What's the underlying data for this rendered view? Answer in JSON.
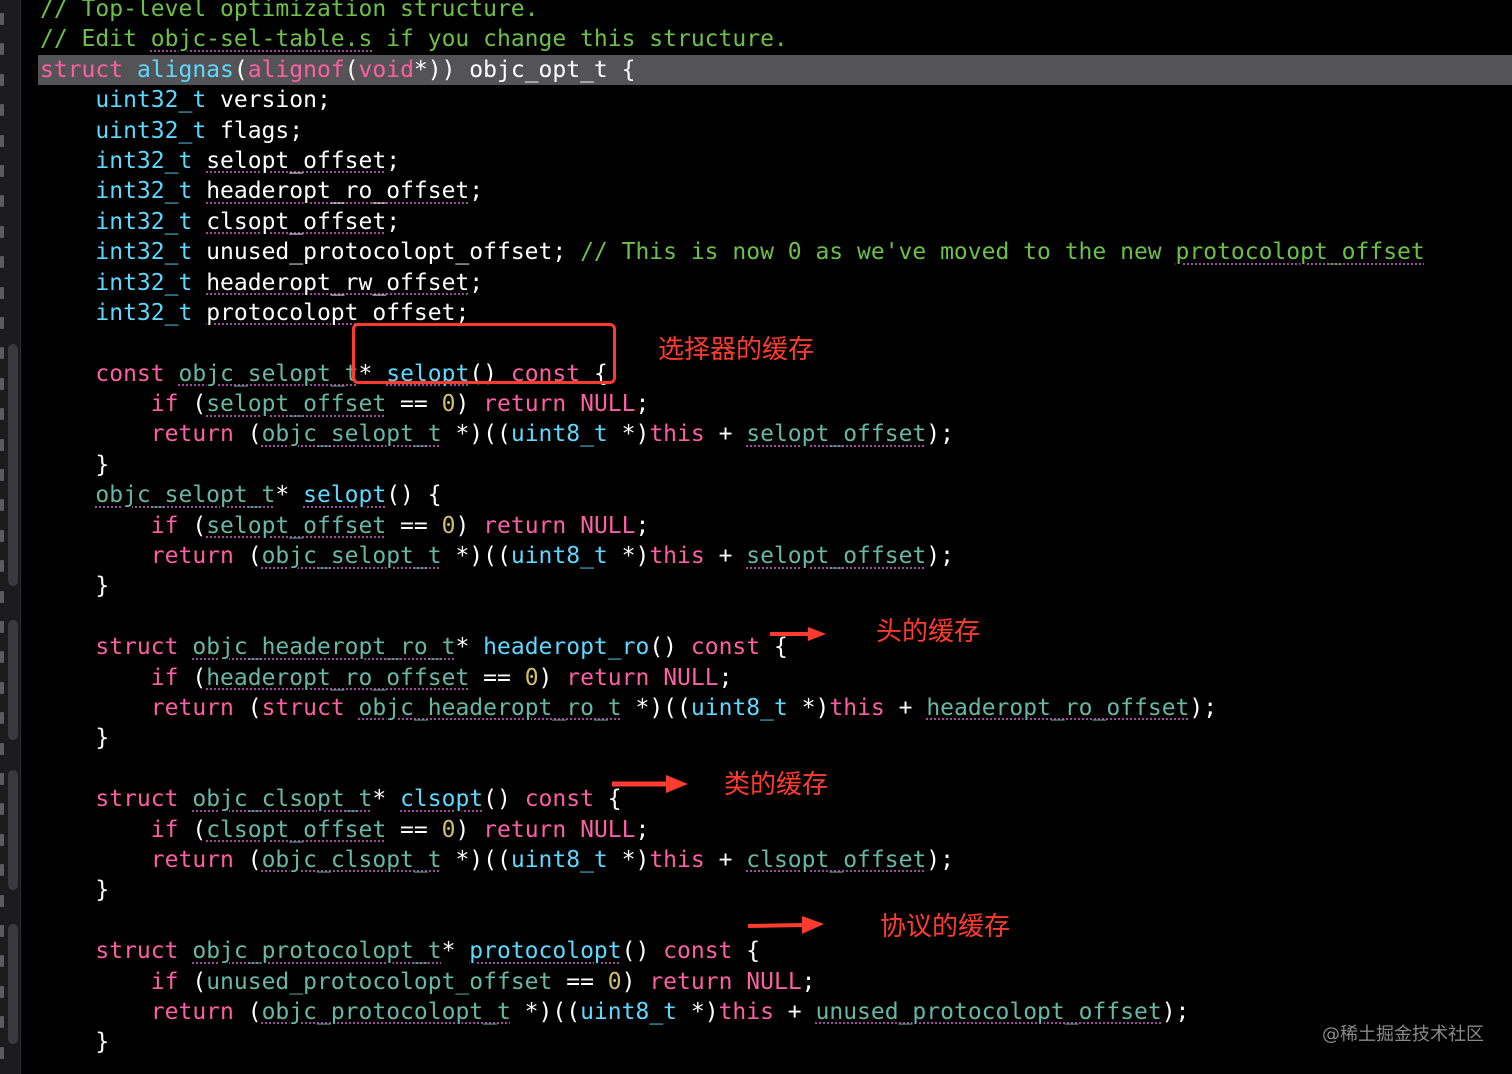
{
  "editor": {
    "lines": [
      [
        [
          "// Top-level optimization structure.",
          "cm"
        ]
      ],
      [
        [
          "// Edit ",
          "cm"
        ],
        [
          "objc-sel-table.s",
          "cm sq"
        ],
        [
          " if you change this structure.",
          "cm"
        ]
      ],
      [
        [
          "struct ",
          "kw"
        ],
        [
          "alignas",
          "ty"
        ],
        [
          "(",
          "pl"
        ],
        [
          "alignof",
          "kw"
        ],
        [
          "(",
          "pl"
        ],
        [
          "void",
          "kw"
        ],
        [
          "*)) objc_opt_t {",
          "pl"
        ]
      ],
      [
        [
          "    ",
          "pl"
        ],
        [
          "uint32_t",
          "ty"
        ],
        [
          " version;",
          "pl"
        ]
      ],
      [
        [
          "    ",
          "pl"
        ],
        [
          "uint32_t",
          "ty"
        ],
        [
          " flags;",
          "pl"
        ]
      ],
      [
        [
          "    ",
          "pl"
        ],
        [
          "int32_t",
          "ty"
        ],
        [
          " ",
          "pl"
        ],
        [
          "selopt_offset",
          "pl sq"
        ],
        [
          ";",
          "pl"
        ]
      ],
      [
        [
          "    ",
          "pl"
        ],
        [
          "int32_t",
          "ty"
        ],
        [
          " ",
          "pl"
        ],
        [
          "headeropt_ro_offset",
          "pl sq"
        ],
        [
          ";",
          "pl"
        ]
      ],
      [
        [
          "    ",
          "pl"
        ],
        [
          "int32_t",
          "ty"
        ],
        [
          " ",
          "pl"
        ],
        [
          "clsopt_offset",
          "pl sq"
        ],
        [
          ";",
          "pl"
        ]
      ],
      [
        [
          "    ",
          "pl"
        ],
        [
          "int32_t",
          "ty"
        ],
        [
          " unused_protocolopt_offset; ",
          "pl"
        ],
        [
          "// This is now 0 as we've moved to the new ",
          "cm"
        ],
        [
          "protocolopt_offset",
          "cm sq"
        ]
      ],
      [
        [
          "    ",
          "pl"
        ],
        [
          "int32_t",
          "ty"
        ],
        [
          " ",
          "pl"
        ],
        [
          "headeropt_rw_offset",
          "pl sq"
        ],
        [
          ";",
          "pl"
        ]
      ],
      [
        [
          "    ",
          "pl"
        ],
        [
          "int32_t",
          "ty"
        ],
        [
          " ",
          "pl"
        ],
        [
          "protocolopt_offset",
          "pl sq"
        ],
        [
          ";",
          "pl"
        ]
      ],
      [],
      [
        [
          "    ",
          "pl"
        ],
        [
          "const",
          "kw"
        ],
        [
          " ",
          "pl"
        ],
        [
          "objc_selopt_t",
          "fn sq"
        ],
        [
          "* ",
          "pl"
        ],
        [
          "selopt",
          "ty sq"
        ],
        [
          "() ",
          "pl"
        ],
        [
          "const",
          "kw"
        ],
        [
          " {",
          "pl"
        ]
      ],
      [
        [
          "        ",
          "pl"
        ],
        [
          "if",
          "kw"
        ],
        [
          " (",
          "pl"
        ],
        [
          "selopt_offset",
          "fn sq"
        ],
        [
          " == ",
          "pl"
        ],
        [
          "0",
          "nm"
        ],
        [
          ") ",
          "pl"
        ],
        [
          "return",
          "kw"
        ],
        [
          " ",
          "pl"
        ],
        [
          "NULL",
          "kw"
        ],
        [
          ";",
          "pl"
        ]
      ],
      [
        [
          "        ",
          "pl"
        ],
        [
          "return",
          "kw"
        ],
        [
          " (",
          "pl"
        ],
        [
          "objc_selopt_t",
          "fn sq"
        ],
        [
          " *)((",
          "pl"
        ],
        [
          "uint8_t",
          "ty"
        ],
        [
          " *)",
          "pl"
        ],
        [
          "this",
          "kw"
        ],
        [
          " + ",
          "pl"
        ],
        [
          "selopt_offset",
          "fn sq"
        ],
        [
          ");",
          "pl"
        ]
      ],
      [
        [
          "    }",
          "pl"
        ]
      ],
      [
        [
          "    ",
          "pl"
        ],
        [
          "objc_selopt_t",
          "fn sq"
        ],
        [
          "* ",
          "pl"
        ],
        [
          "selopt",
          "ty sq"
        ],
        [
          "() {",
          "pl"
        ]
      ],
      [
        [
          "        ",
          "pl"
        ],
        [
          "if",
          "kw"
        ],
        [
          " (",
          "pl"
        ],
        [
          "selopt_offset",
          "fn sq"
        ],
        [
          " == ",
          "pl"
        ],
        [
          "0",
          "nm"
        ],
        [
          ") ",
          "pl"
        ],
        [
          "return",
          "kw"
        ],
        [
          " ",
          "pl"
        ],
        [
          "NULL",
          "kw"
        ],
        [
          ";",
          "pl"
        ]
      ],
      [
        [
          "        ",
          "pl"
        ],
        [
          "return",
          "kw"
        ],
        [
          " (",
          "pl"
        ],
        [
          "objc_selopt_t",
          "fn sq"
        ],
        [
          " *)((",
          "pl"
        ],
        [
          "uint8_t",
          "ty"
        ],
        [
          " *)",
          "pl"
        ],
        [
          "this",
          "kw"
        ],
        [
          " + ",
          "pl"
        ],
        [
          "selopt_offset",
          "fn sq"
        ],
        [
          ");",
          "pl"
        ]
      ],
      [
        [
          "    }",
          "pl"
        ]
      ],
      [],
      [
        [
          "    ",
          "pl"
        ],
        [
          "struct",
          "kw"
        ],
        [
          " ",
          "pl"
        ],
        [
          "objc_headeropt_ro_t",
          "fn sq"
        ],
        [
          "* ",
          "pl"
        ],
        [
          "headeropt_ro",
          "ty"
        ],
        [
          "() ",
          "pl"
        ],
        [
          "const",
          "kw"
        ],
        [
          " {",
          "pl"
        ]
      ],
      [
        [
          "        ",
          "pl"
        ],
        [
          "if",
          "kw"
        ],
        [
          " (",
          "pl"
        ],
        [
          "headeropt_ro_offset",
          "fn sq"
        ],
        [
          " == ",
          "pl"
        ],
        [
          "0",
          "nm"
        ],
        [
          ") ",
          "pl"
        ],
        [
          "return",
          "kw"
        ],
        [
          " ",
          "pl"
        ],
        [
          "NULL",
          "kw"
        ],
        [
          ";",
          "pl"
        ]
      ],
      [
        [
          "        ",
          "pl"
        ],
        [
          "return",
          "kw"
        ],
        [
          " (",
          "pl"
        ],
        [
          "struct",
          "kw"
        ],
        [
          " ",
          "pl"
        ],
        [
          "objc_headeropt_ro_t",
          "fn sq"
        ],
        [
          " *)((",
          "pl"
        ],
        [
          "uint8_t",
          "ty"
        ],
        [
          " *)",
          "pl"
        ],
        [
          "this",
          "kw"
        ],
        [
          " + ",
          "pl"
        ],
        [
          "headeropt_ro_offset",
          "fn sq"
        ],
        [
          ");",
          "pl"
        ]
      ],
      [
        [
          "    }",
          "pl"
        ]
      ],
      [],
      [
        [
          "    ",
          "pl"
        ],
        [
          "struct",
          "kw"
        ],
        [
          " ",
          "pl"
        ],
        [
          "objc_clsopt_t",
          "fn sq"
        ],
        [
          "* ",
          "pl"
        ],
        [
          "clsopt",
          "ty sq"
        ],
        [
          "() ",
          "pl"
        ],
        [
          "const",
          "kw"
        ],
        [
          " {",
          "pl"
        ]
      ],
      [
        [
          "        ",
          "pl"
        ],
        [
          "if",
          "kw"
        ],
        [
          " (",
          "pl"
        ],
        [
          "clsopt_offset",
          "fn sq"
        ],
        [
          " == ",
          "pl"
        ],
        [
          "0",
          "nm"
        ],
        [
          ") ",
          "pl"
        ],
        [
          "return",
          "kw"
        ],
        [
          " ",
          "pl"
        ],
        [
          "NULL",
          "kw"
        ],
        [
          ";",
          "pl"
        ]
      ],
      [
        [
          "        ",
          "pl"
        ],
        [
          "return",
          "kw"
        ],
        [
          " (",
          "pl"
        ],
        [
          "objc_clsopt_t",
          "fn sq"
        ],
        [
          " *)((",
          "pl"
        ],
        [
          "uint8_t",
          "ty"
        ],
        [
          " *)",
          "pl"
        ],
        [
          "this",
          "kw"
        ],
        [
          " + ",
          "pl"
        ],
        [
          "clsopt_offset",
          "fn sq"
        ],
        [
          ");",
          "pl"
        ]
      ],
      [
        [
          "    }",
          "pl"
        ]
      ],
      [],
      [
        [
          "    ",
          "pl"
        ],
        [
          "struct",
          "kw"
        ],
        [
          " ",
          "pl"
        ],
        [
          "objc_protocolopt_t",
          "fn sq"
        ],
        [
          "* ",
          "pl"
        ],
        [
          "protocolopt",
          "ty sq"
        ],
        [
          "() ",
          "pl"
        ],
        [
          "const",
          "kw"
        ],
        [
          " {",
          "pl"
        ]
      ],
      [
        [
          "        ",
          "pl"
        ],
        [
          "if",
          "kw"
        ],
        [
          " (",
          "pl"
        ],
        [
          "unused_protocolopt_offset",
          "fn"
        ],
        [
          " == ",
          "pl"
        ],
        [
          "0",
          "nm"
        ],
        [
          ") ",
          "pl"
        ],
        [
          "return",
          "kw"
        ],
        [
          " ",
          "pl"
        ],
        [
          "NULL",
          "kw"
        ],
        [
          ";",
          "pl"
        ]
      ],
      [
        [
          "        ",
          "pl"
        ],
        [
          "return",
          "kw"
        ],
        [
          " (",
          "pl"
        ],
        [
          "objc_protocolopt_t",
          "fn sq"
        ],
        [
          " *)((",
          "pl"
        ],
        [
          "uint8_t",
          "ty"
        ],
        [
          " *)",
          "pl"
        ],
        [
          "this",
          "kw"
        ],
        [
          " + ",
          "pl"
        ],
        [
          "unused_protocolopt_offset",
          "fn sq"
        ],
        [
          ");",
          "pl"
        ]
      ],
      [
        [
          "    }",
          "pl"
        ]
      ]
    ]
  },
  "annotations": {
    "selector_cache": "选择器的缓存",
    "header_cache": "头的缓存",
    "class_cache": "类的缓存",
    "protocol_cache": "协议的缓存",
    "color": "#ff3b30"
  },
  "watermark": "@稀土掘金技术社区"
}
